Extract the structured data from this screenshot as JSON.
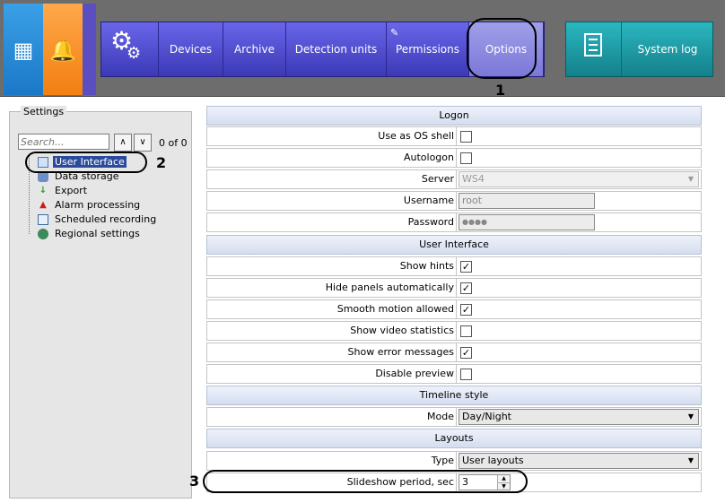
{
  "toolbar": {
    "nav": [
      "Devices",
      "Archive",
      "Detection units",
      "Permissions",
      "Options"
    ],
    "active": "Options",
    "system_log": "System log",
    "icons": {
      "windows": "windows-tile-icon",
      "alarm": "bell-icon",
      "settings": "gears-icon",
      "permissions": "pencil-icon",
      "log": "list-document-icon"
    }
  },
  "left_panel": {
    "title": "Settings",
    "search_placeholder": "Search...",
    "search_count": "0 of 0",
    "tree": [
      {
        "label": "User Interface",
        "icon": "monitor-icon",
        "selected": true
      },
      {
        "label": "Data storage",
        "icon": "database-icon"
      },
      {
        "label": "Export",
        "icon": "export-icon"
      },
      {
        "label": "Alarm processing",
        "icon": "alarm-icon"
      },
      {
        "label": "Scheduled recording",
        "icon": "calendar-icon"
      },
      {
        "label": "Regional settings",
        "icon": "globe-icon"
      }
    ]
  },
  "sections": {
    "logon": "Logon",
    "user_interface": "User Interface",
    "timeline": "Timeline style",
    "layouts": "Layouts"
  },
  "logon": {
    "use_as_os_shell": {
      "label": "Use as OS shell",
      "checked": false
    },
    "autologon": {
      "label": "Autologon",
      "checked": false
    },
    "server": {
      "label": "Server",
      "value": "WS4"
    },
    "username": {
      "label": "Username",
      "value": "root"
    },
    "password": {
      "label": "Password",
      "value": "●●●●"
    }
  },
  "ui": {
    "show_hints": {
      "label": "Show hints",
      "checked": true
    },
    "hide_panels": {
      "label": "Hide panels automatically",
      "checked": true
    },
    "smooth_motion": {
      "label": "Smooth motion allowed",
      "checked": true
    },
    "video_stats": {
      "label": "Show video statistics",
      "checked": false
    },
    "error_messages": {
      "label": "Show error messages",
      "checked": true
    },
    "disable_preview": {
      "label": "Disable preview",
      "checked": false
    }
  },
  "timeline": {
    "mode": {
      "label": "Mode",
      "value": "Day/Night"
    }
  },
  "layouts": {
    "type": {
      "label": "Type",
      "value": "User layouts"
    },
    "slideshow": {
      "label": "Slideshow period, sec",
      "value": "3"
    }
  },
  "callouts": [
    "1",
    "2",
    "3"
  ],
  "glyphs": {
    "check": "✓",
    "dropdown": "▼",
    "up": "▲",
    "down": "▼",
    "sort_up": "∧",
    "sort_down": "∨"
  },
  "colors": {
    "nav_blue": "#4a47c8",
    "active_nav": "#8c8ade",
    "teal": "#1f9aa4",
    "orange": "#f5901f",
    "windows_blue": "#2a8ad9",
    "selection": "#2a4b9c"
  }
}
